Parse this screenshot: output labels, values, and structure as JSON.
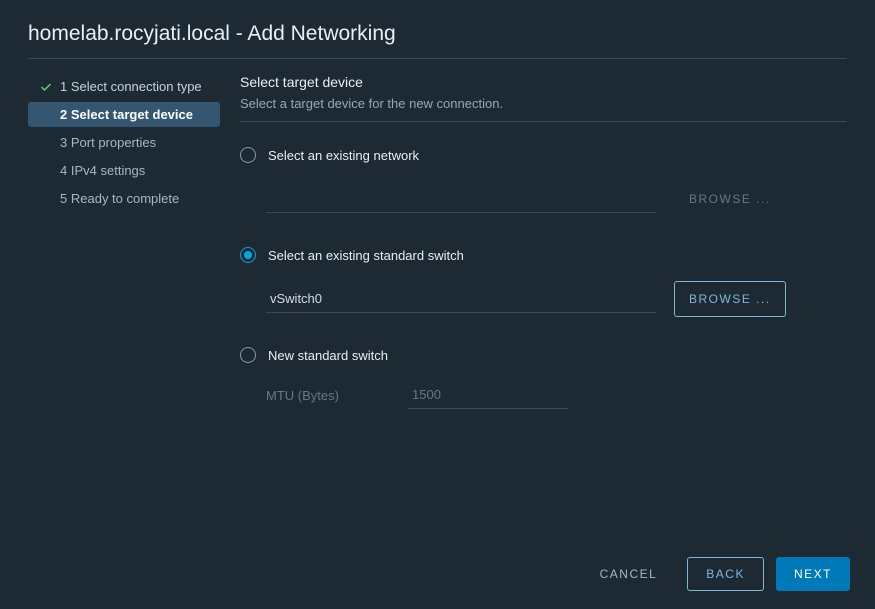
{
  "title": "homelab.rocyjati.local - Add Networking",
  "wizard": {
    "steps": [
      {
        "num": "1",
        "label": "Select connection type",
        "state": "done"
      },
      {
        "num": "2",
        "label": "Select target device",
        "state": "active"
      },
      {
        "num": "3",
        "label": "Port properties",
        "state": "pending"
      },
      {
        "num": "4",
        "label": "IPv4 settings",
        "state": "pending"
      },
      {
        "num": "5",
        "label": "Ready to complete",
        "state": "pending"
      }
    ]
  },
  "section": {
    "title": "Select target device",
    "desc": "Select a target device for the new connection."
  },
  "options": {
    "existing_network": {
      "label": "Select an existing network",
      "value": "",
      "browse": "BROWSE ..."
    },
    "existing_switch": {
      "label": "Select an existing standard switch",
      "value": "vSwitch0",
      "browse": "BROWSE ..."
    },
    "new_switch": {
      "label": "New standard switch",
      "mtu_label": "MTU (Bytes)",
      "mtu_value": "1500"
    }
  },
  "footer": {
    "cancel": "CANCEL",
    "back": "BACK",
    "next": "NEXT"
  },
  "selected_option": "existing_switch"
}
